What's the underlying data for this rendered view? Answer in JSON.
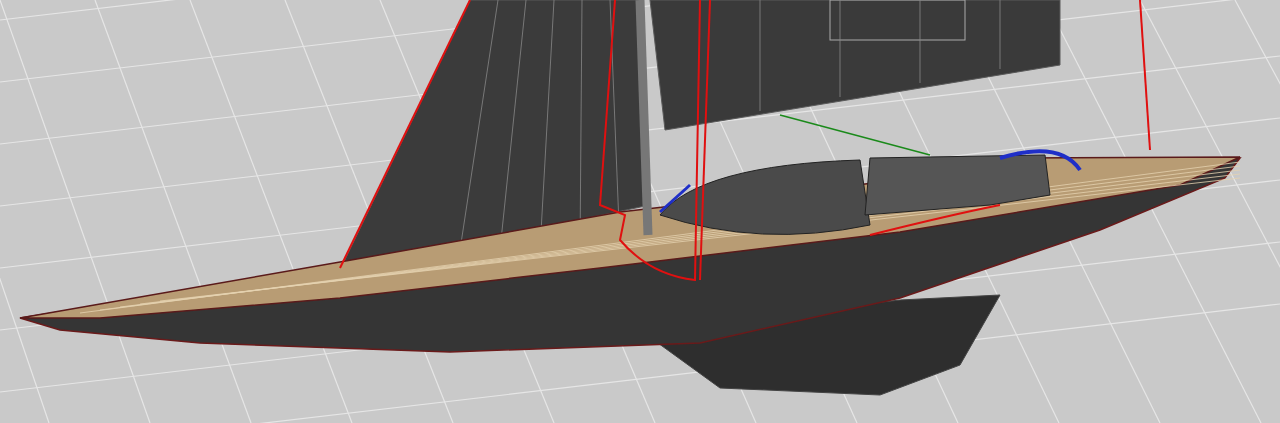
{
  "viewport": {
    "kind": "perspective",
    "model": {
      "kind": "sailboat"
    }
  }
}
